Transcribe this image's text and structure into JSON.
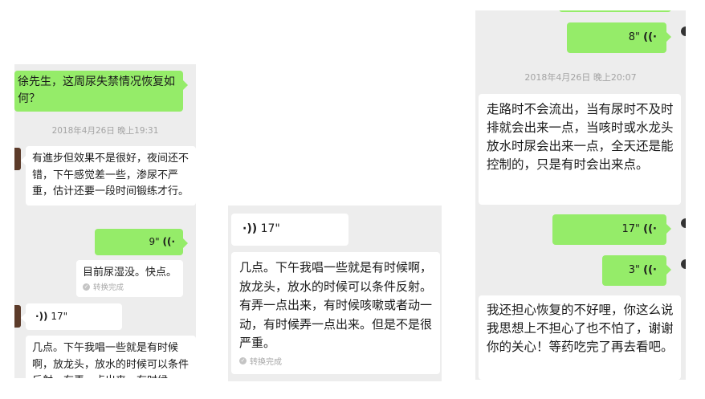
{
  "colors": {
    "panel_bg": "#ededed",
    "sent_bubble": "#95ec69",
    "received_bubble": "#ffffff"
  },
  "panel1": {
    "msg_question": "徐先生，这周尿失禁情况恢复如何？",
    "timestamp": "2018年4月26日 晚上19:31",
    "reply_text": "有進步但效果不是很好，夜间还不错，下午感觉差一些，渗尿不严重，估计还要一段时间锻练才行。",
    "voice_sent_duration": "9\"",
    "transcript_short": "目前尿湿没。快点。",
    "convert_done": "转换完成",
    "voice_recv_duration": "17\"",
    "transcript_long": "几点。下午我唱一些就是有时候啊，放龙头，放水的时候可以条件反射。有弄一点出来，有时候"
  },
  "panel2": {
    "voice_recv_duration": "17\"",
    "transcript": "几点。下午我唱一些就是有时候啊，放龙头，放水的时候可以条件反射。有弄一点出来，有时候咳嗽或者动一动，有时候弄一点出来。但是不是很严重。",
    "convert_done": "转换完成"
  },
  "panel3": {
    "voice_sent_1": "8\"",
    "timestamp": "2018年4月26日 晚上20:07",
    "reply_text": "走路时不会流出，当有尿时不及时排就会出来一点，当咳时或水龙头放水时尿会出来一点，全天还是能控制的，只是有时会出来点。",
    "voice_sent_2": "17\"",
    "voice_sent_3": "3\"",
    "reply_text_2": "我还担心恢复的不好哩，你这么说我思想上不担心了也不怕了，谢谢你的关心！等药吃完了再去看吧。"
  }
}
